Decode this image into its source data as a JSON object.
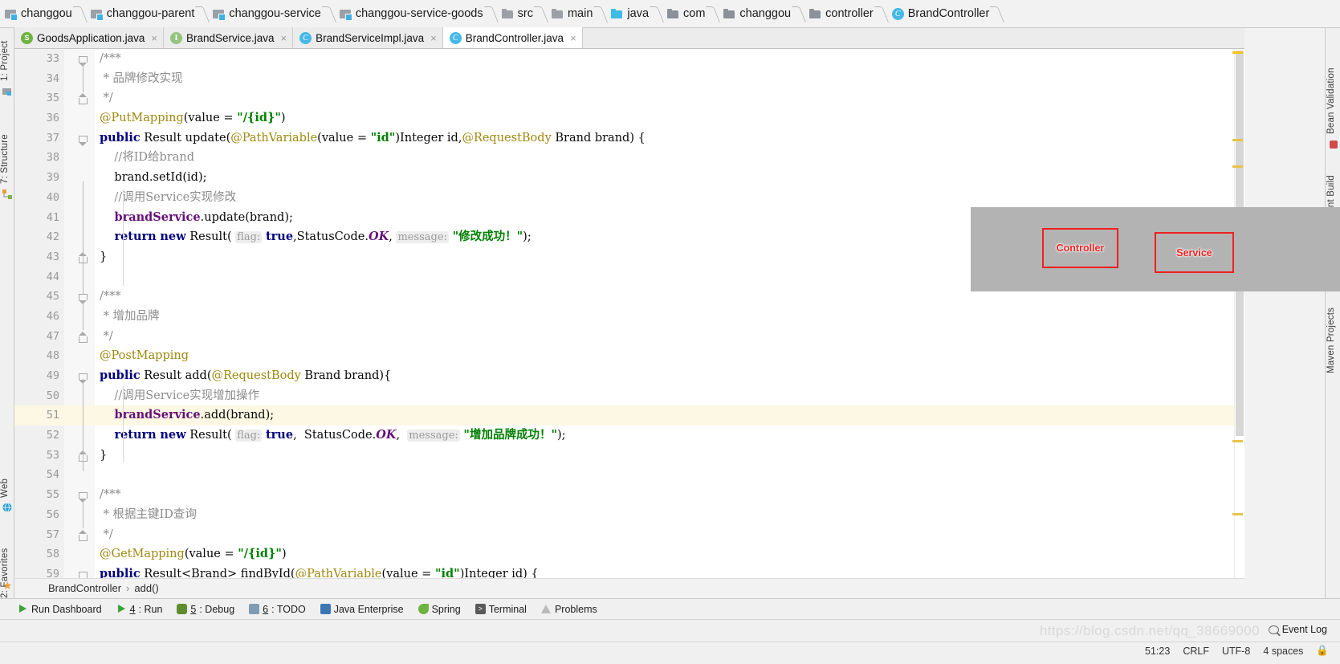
{
  "breadcrumb": {
    "items": [
      {
        "label": "changgou",
        "icon": "module-icon"
      },
      {
        "label": "changgou-parent",
        "icon": "module-icon"
      },
      {
        "label": "changgou-service",
        "icon": "module-icon"
      },
      {
        "label": "changgou-service-goods",
        "icon": "module-icon"
      },
      {
        "label": "src",
        "icon": "folder-icon"
      },
      {
        "label": "main",
        "icon": "folder-icon"
      },
      {
        "label": "java",
        "icon": "folder-blue-icon"
      },
      {
        "label": "com",
        "icon": "folder-dark-icon"
      },
      {
        "label": "changgou",
        "icon": "folder-dark-icon"
      },
      {
        "label": "controller",
        "icon": "folder-dark-icon"
      },
      {
        "label": "BrandController",
        "icon": "class-icon"
      }
    ]
  },
  "tabs": [
    {
      "label": "GoodsApplication.java",
      "icon": "spring-class-icon",
      "active": false,
      "close": "×"
    },
    {
      "label": "BrandService.java",
      "icon": "interface-icon",
      "active": false,
      "close": "×"
    },
    {
      "label": "BrandServiceImpl.java",
      "icon": "class-icon",
      "active": false,
      "close": "×"
    },
    {
      "label": "BrandController.java",
      "icon": "class-icon",
      "active": true,
      "close": "×"
    }
  ],
  "editor": {
    "first_line": 33,
    "highlighted_line": 51,
    "lines": [
      {
        "n": 33,
        "fold": "arrow-dn",
        "segs": [
          {
            "t": "/***",
            "c": "cmt"
          }
        ]
      },
      {
        "n": 34,
        "fold": "",
        "segs": [
          {
            "t": " * 品牌修改实现",
            "c": "cmt"
          }
        ]
      },
      {
        "n": 35,
        "fold": "arrow-up",
        "segs": [
          {
            "t": " */",
            "c": "cmt"
          }
        ]
      },
      {
        "n": 36,
        "fold": "",
        "segs": [
          {
            "t": "@PutMapping",
            "c": "anno"
          },
          {
            "t": "(value = ",
            "c": ""
          },
          {
            "t": "\"/{id}\"",
            "c": "str"
          },
          {
            "t": ")",
            "c": ""
          }
        ]
      },
      {
        "n": 37,
        "fold": "arrow-dn",
        "segs": [
          {
            "t": "public",
            "c": "kw"
          },
          {
            "t": " Result update(",
            "c": ""
          },
          {
            "t": "@PathVariable",
            "c": "anno"
          },
          {
            "t": "(value = ",
            "c": ""
          },
          {
            "t": "\"id\"",
            "c": "str"
          },
          {
            "t": ")Integer id,",
            "c": ""
          },
          {
            "t": "@RequestBody",
            "c": "anno"
          },
          {
            "t": " Brand brand) {",
            "c": ""
          }
        ]
      },
      {
        "n": 38,
        "fold": "",
        "indent": 1,
        "segs": [
          {
            "t": "    //将ID给brand",
            "c": "cmt"
          }
        ]
      },
      {
        "n": 39,
        "fold": "",
        "indent": 1,
        "segs": [
          {
            "t": "    brand.setId(id);",
            "c": ""
          }
        ]
      },
      {
        "n": 40,
        "fold": "",
        "indent": 1,
        "segs": [
          {
            "t": "    //调用Service实现修改",
            "c": "cmt"
          }
        ]
      },
      {
        "n": 41,
        "fold": "",
        "indent": 1,
        "segs": [
          {
            "t": "    ",
            "c": ""
          },
          {
            "t": "brandService",
            "c": "fld"
          },
          {
            "t": ".update(brand);",
            "c": ""
          }
        ]
      },
      {
        "n": 42,
        "fold": "",
        "indent": 1,
        "segs": [
          {
            "t": "    ",
            "c": ""
          },
          {
            "t": "return",
            "c": "kw"
          },
          {
            "t": " ",
            "c": ""
          },
          {
            "t": "new",
            "c": "kw"
          },
          {
            "t": " Result( ",
            "c": ""
          },
          {
            "t": "flag:",
            "c": "hint"
          },
          {
            "t": " ",
            "c": ""
          },
          {
            "t": "true",
            "c": "kw"
          },
          {
            "t": ",StatusCode.",
            "c": ""
          },
          {
            "t": "OK",
            "c": "sconst"
          },
          {
            "t": ", ",
            "c": ""
          },
          {
            "t": "message:",
            "c": "hint"
          },
          {
            "t": " ",
            "c": ""
          },
          {
            "t": "\"修改成功！\"",
            "c": "str"
          },
          {
            "t": ");",
            "c": ""
          }
        ]
      },
      {
        "n": 43,
        "fold": "arrow-up",
        "segs": [
          {
            "t": "}",
            "c": ""
          }
        ]
      },
      {
        "n": 44,
        "fold": "",
        "segs": []
      },
      {
        "n": 45,
        "fold": "arrow-dn",
        "segs": [
          {
            "t": "/***",
            "c": "cmt"
          }
        ]
      },
      {
        "n": 46,
        "fold": "",
        "segs": [
          {
            "t": " * 增加品牌",
            "c": "cmt"
          }
        ]
      },
      {
        "n": 47,
        "fold": "arrow-up",
        "segs": [
          {
            "t": " */",
            "c": "cmt"
          }
        ]
      },
      {
        "n": 48,
        "fold": "",
        "segs": [
          {
            "t": "@PostMapping",
            "c": "anno"
          }
        ]
      },
      {
        "n": 49,
        "fold": "arrow-dn",
        "segs": [
          {
            "t": "public",
            "c": "kw"
          },
          {
            "t": " Result add(",
            "c": ""
          },
          {
            "t": "@RequestBody",
            "c": "anno"
          },
          {
            "t": " Brand brand){",
            "c": ""
          }
        ]
      },
      {
        "n": 50,
        "fold": "",
        "indent": 1,
        "segs": [
          {
            "t": "    //调用Service实现增加操作",
            "c": "cmt"
          }
        ]
      },
      {
        "n": 51,
        "fold": "",
        "indent": 1,
        "hl": true,
        "segs": [
          {
            "t": "    ",
            "c": ""
          },
          {
            "t": "brandService",
            "c": "fld"
          },
          {
            "t": ".add(brand);",
            "c": ""
          }
        ]
      },
      {
        "n": 52,
        "fold": "",
        "indent": 1,
        "segs": [
          {
            "t": "    ",
            "c": ""
          },
          {
            "t": "return",
            "c": "kw"
          },
          {
            "t": " ",
            "c": ""
          },
          {
            "t": "new",
            "c": "kw"
          },
          {
            "t": " Result( ",
            "c": ""
          },
          {
            "t": "flag:",
            "c": "hint"
          },
          {
            "t": " ",
            "c": ""
          },
          {
            "t": "true",
            "c": "kw"
          },
          {
            "t": ",  StatusCode.",
            "c": ""
          },
          {
            "t": "OK",
            "c": "sconst"
          },
          {
            "t": ",  ",
            "c": ""
          },
          {
            "t": "message:",
            "c": "hint"
          },
          {
            "t": " ",
            "c": ""
          },
          {
            "t": "\"增加品牌成功！\"",
            "c": "str"
          },
          {
            "t": ");",
            "c": ""
          }
        ]
      },
      {
        "n": 53,
        "fold": "arrow-up",
        "segs": [
          {
            "t": "}",
            "c": ""
          }
        ]
      },
      {
        "n": 54,
        "fold": "",
        "segs": []
      },
      {
        "n": 55,
        "fold": "arrow-dn",
        "segs": [
          {
            "t": "/***",
            "c": "cmt"
          }
        ]
      },
      {
        "n": 56,
        "fold": "",
        "segs": [
          {
            "t": " * 根据主键ID查询",
            "c": "cmt"
          }
        ]
      },
      {
        "n": 57,
        "fold": "arrow-up",
        "segs": [
          {
            "t": " */",
            "c": "cmt"
          }
        ]
      },
      {
        "n": 58,
        "fold": "",
        "segs": [
          {
            "t": "@GetMapping",
            "c": "anno"
          },
          {
            "t": "(value = ",
            "c": ""
          },
          {
            "t": "\"/{id}\"",
            "c": "str"
          },
          {
            "t": ")",
            "c": ""
          }
        ]
      },
      {
        "n": 59,
        "fold": "arrow-dn",
        "segs": [
          {
            "t": "public",
            "c": "kw"
          },
          {
            "t": " Result<Brand> findById(",
            "c": ""
          },
          {
            "t": "@PathVariable",
            "c": "anno"
          },
          {
            "t": "(value = ",
            "c": ""
          },
          {
            "t": "\"id\"",
            "c": "str"
          },
          {
            "t": ")Integer id) {",
            "c": ""
          }
        ]
      }
    ]
  },
  "annotation_overlay": {
    "background_color": "#b3b3b3",
    "border_color": "#f02020",
    "boxes": [
      {
        "label": "Controller"
      },
      {
        "label": "Service"
      }
    ]
  },
  "structure_path": {
    "class": "BrandController",
    "separator": "›",
    "member": "add()"
  },
  "left_tool_window": {
    "items": [
      {
        "label": "1: Project",
        "icon": "project-icon"
      },
      {
        "label": "7: Structure",
        "icon": "structure-icon"
      },
      {
        "label": "Web",
        "icon": "globe-icon"
      },
      {
        "label": "2: Favorites",
        "icon": "star-icon"
      }
    ]
  },
  "right_tool_window": {
    "items": [
      {
        "label": "Bean Validation",
        "icon": "bean-icon"
      },
      {
        "label": "Ant Build",
        "icon": "ant-icon"
      },
      {
        "label": "Maven Projects",
        "icon": "maven-icon"
      }
    ]
  },
  "bottom_tool_window": {
    "items": [
      {
        "label": "Run Dashboard",
        "mnemonic": "",
        "icon": "run-icon"
      },
      {
        "label": ": Run",
        "mnemonic": "4",
        "icon": "play-icon"
      },
      {
        "label": ": Debug",
        "mnemonic": "5",
        "icon": "debug-icon"
      },
      {
        "label": ": TODO",
        "mnemonic": "6",
        "icon": "todo-icon"
      },
      {
        "label": "Java Enterprise",
        "mnemonic": "",
        "icon": "java-enterprise-icon"
      },
      {
        "label": "Spring",
        "mnemonic": "",
        "icon": "spring-icon"
      },
      {
        "label": "Terminal",
        "mnemonic": "",
        "icon": "terminal-icon"
      },
      {
        "label": "Problems",
        "mnemonic": "",
        "icon": "problems-icon"
      }
    ]
  },
  "status_bar": {
    "event_log": "Event Log",
    "caret_position": "51:23",
    "line_separator": "CRLF",
    "encoding": "UTF-8",
    "indent": "4 spaces"
  },
  "watermark": "https://blog.csdn.net/qq_38669000"
}
